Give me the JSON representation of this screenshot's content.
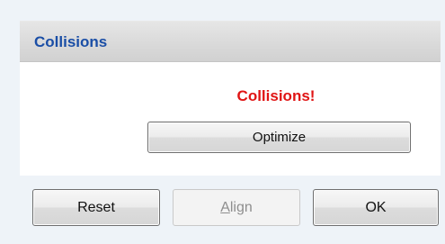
{
  "panel": {
    "title": "Collisions"
  },
  "status": {
    "text": "Collisions!",
    "color": "#e01515"
  },
  "buttons": {
    "optimize_label": "Optimize",
    "reset_label": "Reset",
    "align_mnemonic": "A",
    "align_rest": "lign",
    "align_enabled": false,
    "ok_label": "OK"
  },
  "colors": {
    "title": "#1a4ea6",
    "background": "#eef3f8"
  }
}
